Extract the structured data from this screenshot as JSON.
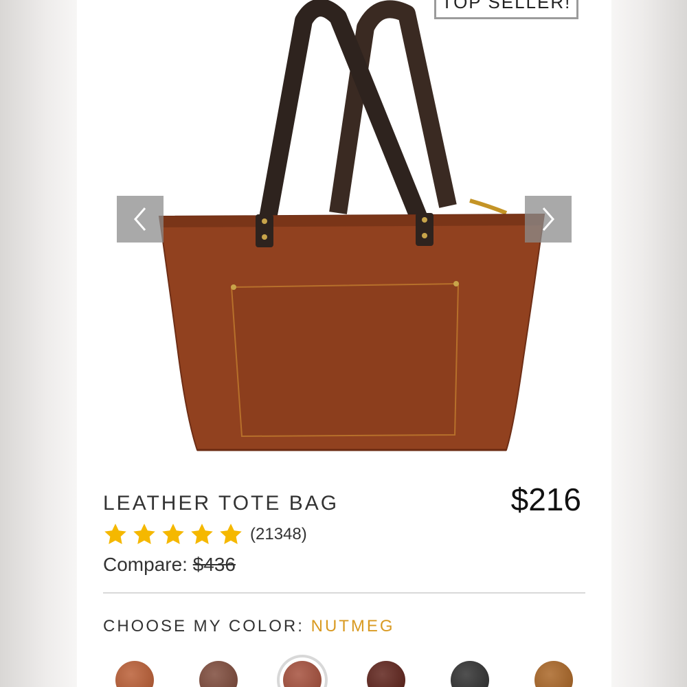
{
  "badge": {
    "label": "TOP SELLER!"
  },
  "product": {
    "title": "LEATHER TOTE BAG",
    "price": "$216",
    "rating": 5,
    "review_count": "(21348)",
    "compare_label": "Compare:",
    "compare_price": "$436"
  },
  "color_picker": {
    "label": "CHOOSE MY COLOR:",
    "selected": "NUTMEG",
    "accent_color": "#d99a22",
    "swatches": [
      {
        "color": "#b8592f"
      },
      {
        "color": "#7a4535"
      },
      {
        "color": "#a24a36",
        "selected": true
      },
      {
        "color": "#5a1c14"
      },
      {
        "color": "#2a2a2a"
      },
      {
        "color": "#a7611f"
      }
    ]
  },
  "icons": {
    "prev": "chevron-left-icon",
    "next": "chevron-right-icon",
    "rating": "star-icon"
  }
}
